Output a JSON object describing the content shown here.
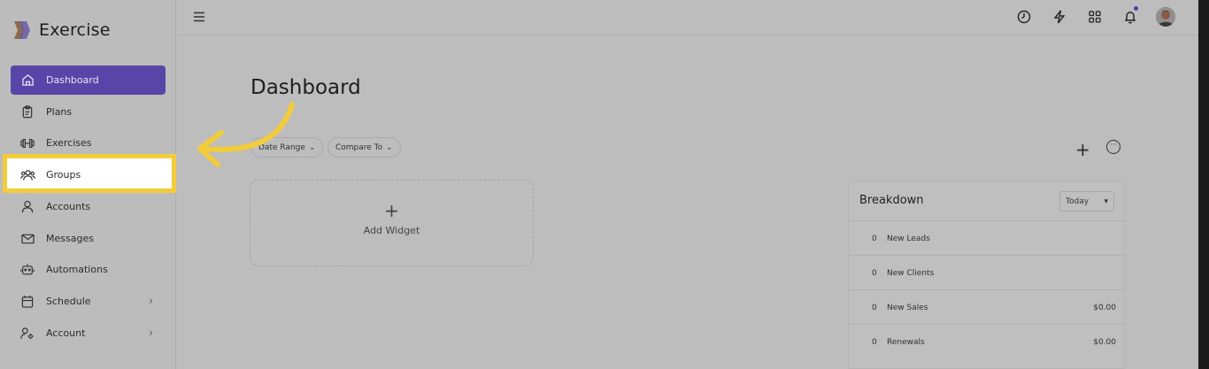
{
  "app": {
    "name": "Exercise"
  },
  "sidebar": {
    "items": [
      {
        "label": "Dashboard",
        "icon": "home-icon"
      },
      {
        "label": "Plans",
        "icon": "clipboard-icon"
      },
      {
        "label": "Exercises",
        "icon": "dumbbell-icon"
      },
      {
        "label": "Groups",
        "icon": "users-icon"
      },
      {
        "label": "Accounts",
        "icon": "user-icon"
      },
      {
        "label": "Messages",
        "icon": "mail-icon"
      },
      {
        "label": "Automations",
        "icon": "robot-icon"
      },
      {
        "label": "Schedule",
        "icon": "calendar-icon"
      },
      {
        "label": "Account",
        "icon": "user-settings-icon"
      }
    ],
    "active": "Dashboard",
    "highlighted": "Groups"
  },
  "topbar": {
    "icons": [
      "clock-icon",
      "bolt-icon",
      "apps-grid-icon",
      "bell-icon",
      "avatar"
    ]
  },
  "main": {
    "title": "Dashboard",
    "filters": {
      "date_range": "Date Range",
      "compare_to": "Compare To"
    },
    "add_widget": "Add Widget"
  },
  "breakdown": {
    "title": "Breakdown",
    "period": "Today",
    "rows": [
      {
        "count": "0",
        "label": "New Leads",
        "value": ""
      },
      {
        "count": "0",
        "label": "New Clients",
        "value": ""
      },
      {
        "count": "0",
        "label": "New Sales",
        "value": "$0.00"
      },
      {
        "count": "0",
        "label": "Renewals",
        "value": "$0.00"
      }
    ]
  },
  "colors": {
    "accent": "#5746a8",
    "highlight": "#f3cc3b",
    "overlay": "#bdbdbd"
  }
}
